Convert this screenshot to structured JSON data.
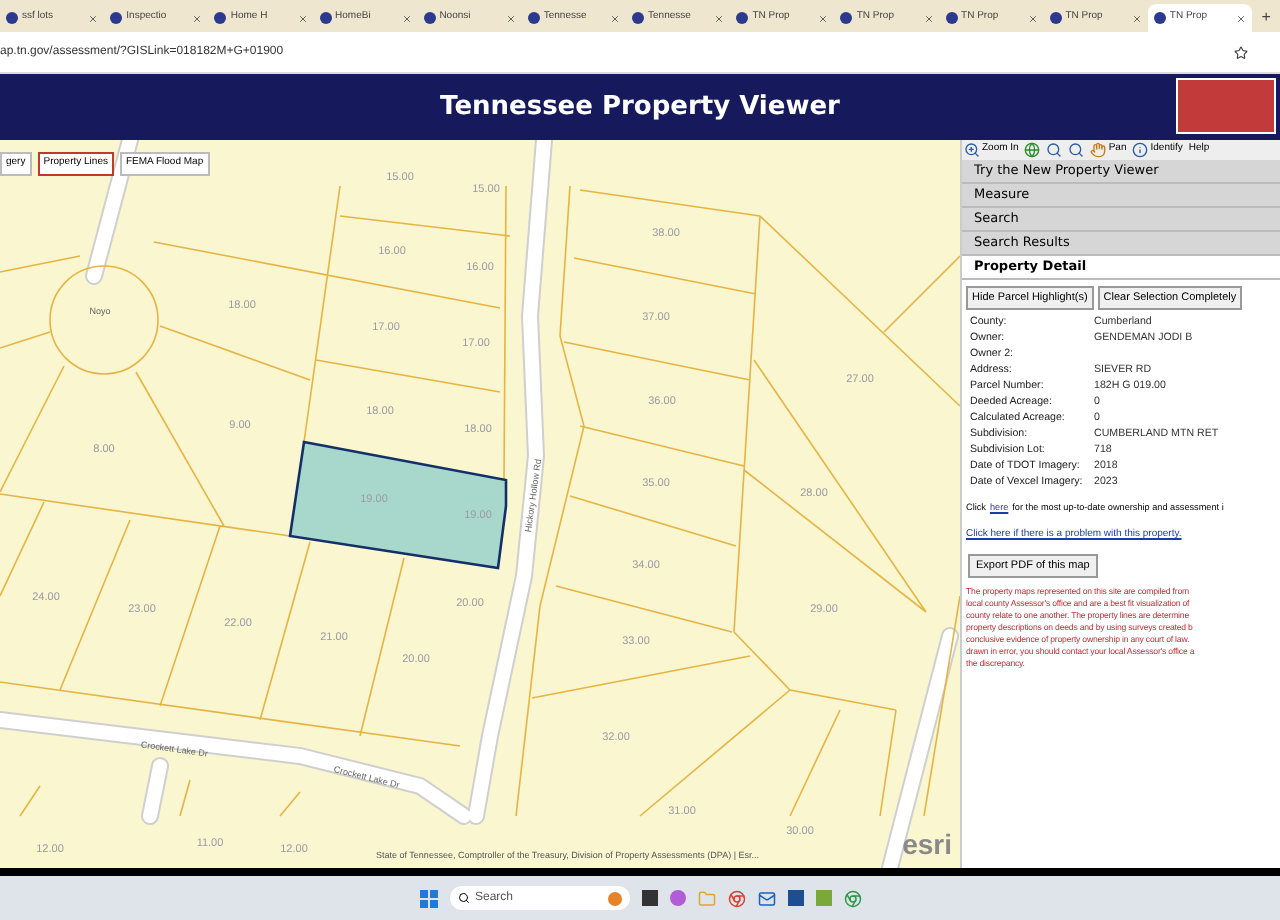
{
  "browser": {
    "tabs": [
      {
        "label": "ssf lots",
        "selected": false
      },
      {
        "label": "Inspectio",
        "selected": false
      },
      {
        "label": "Home H",
        "selected": false
      },
      {
        "label": "HomeBi",
        "selected": false
      },
      {
        "label": "Noonsi",
        "selected": false
      },
      {
        "label": "Tennesse",
        "selected": false
      },
      {
        "label": "Tennesse",
        "selected": false
      },
      {
        "label": "TN Prop",
        "selected": false
      },
      {
        "label": "TN Prop",
        "selected": false
      },
      {
        "label": "TN Prop",
        "selected": false
      },
      {
        "label": "TN Prop",
        "selected": false
      },
      {
        "label": "TN Prop",
        "selected": true
      }
    ],
    "new_tab": "+",
    "url": "ap.tn.gov/assessment/?GISLink=018182M+G+01900"
  },
  "header": {
    "title": "Tennessee Property Viewer"
  },
  "map": {
    "layers": [
      {
        "label": "gery",
        "selected": false
      },
      {
        "label": "Property Lines",
        "selected": true
      },
      {
        "label": "FEMA Flood Map",
        "selected": false
      }
    ],
    "parcel_labels": [
      "15.00",
      "15.00",
      "16.00",
      "16.00",
      "18.00",
      "17.00",
      "17.00",
      "38.00",
      "37.00",
      "36.00",
      "27.00",
      "18.00",
      "18.00",
      "9.00",
      "8.00",
      "19.00",
      "19.00",
      "35.00",
      "28.00",
      "34.00",
      "24.00",
      "23.00",
      "22.00",
      "21.00",
      "20.00",
      "20.00",
      "33.00",
      "29.00",
      "32.00",
      "31.00",
      "30.00",
      "12.00",
      "11.00",
      "12.00"
    ],
    "street_labels": [
      "Noyo",
      "Hickory Hollow Rd",
      "Crockett Lake Dr",
      "Crockett Lake Dr"
    ],
    "attribution": "State of Tennessee, Comptroller of the Treasury, Division of Property Assessments (DPA) | Esr...",
    "logo_text": "esri"
  },
  "panel": {
    "toolbar": [
      {
        "kind": "zoom",
        "label": "Zoom In"
      },
      {
        "kind": "globe"
      },
      {
        "kind": "magnifier"
      },
      {
        "kind": "magnifier"
      },
      {
        "kind": "pan",
        "label": "Pan"
      },
      {
        "kind": "info",
        "label": "Identify"
      },
      {
        "kind": "text",
        "label": "Help"
      }
    ],
    "sections": [
      {
        "label": "Try the New Property Viewer",
        "selected": false
      },
      {
        "label": "Measure",
        "selected": false
      },
      {
        "label": "Search",
        "selected": false
      },
      {
        "label": "Search Results",
        "selected": false
      },
      {
        "label": "Property Detail",
        "selected": true
      }
    ],
    "buttons": [
      "Hide Parcel Highlight(s)",
      "Clear Selection Completely"
    ],
    "details": [
      {
        "label": "County:",
        "value": "Cumberland"
      },
      {
        "label": "Owner:",
        "value": "GENDEMAN JODI B"
      },
      {
        "label": "Owner 2:"
      },
      {
        "label": "Address:",
        "value": "SIEVER RD"
      },
      {
        "label": "Parcel Number:",
        "value": "182H G 019.00"
      },
      {
        "label": "Deeded Acreage:",
        "value": "0"
      },
      {
        "label": "Calculated Acreage:",
        "value": "0"
      },
      {
        "label": "Subdivision:",
        "value": "CUMBERLAND MTN RET"
      },
      {
        "label": "Subdivision Lot:",
        "value": "718"
      },
      {
        "label": "Date of TDOT Imagery:",
        "value": "2018"
      },
      {
        "label": "Date of Vexcel Imagery:",
        "value": "2023"
      }
    ],
    "info_line": {
      "before": "Click",
      "link": "here",
      "after": "for the most up-to-date ownership and assessment i"
    },
    "problem_link": "Click here if there is a problem with this property.",
    "export_button": "Export PDF of this map",
    "disclaimer": [
      "The property maps represented on this site are compiled from",
      "local county Assessor's office and are a best fit visualization of",
      "county relate to one another. The property lines are determine",
      "property descriptions on deeds and by using surveys created b",
      "conclusive evidence of property ownership in any court of law.",
      "drawn in error, you should contact your local Assessor's office a",
      "the discrepancy."
    ]
  },
  "taskbar": {
    "search_placeholder": "Search"
  }
}
